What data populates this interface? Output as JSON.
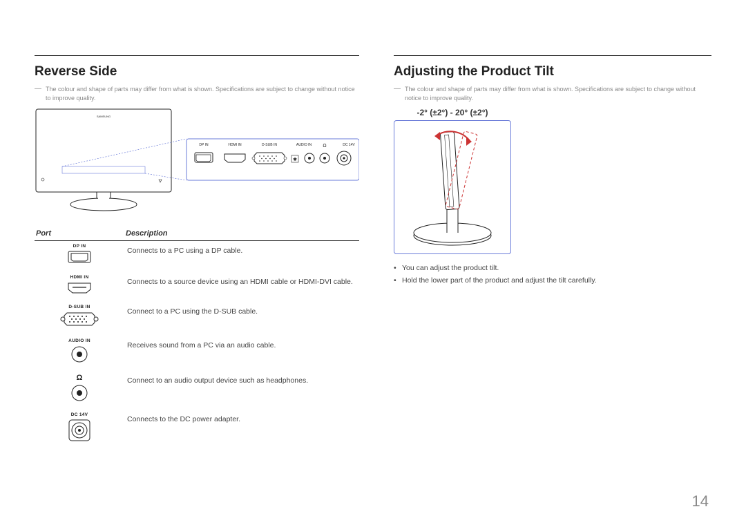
{
  "page_number": "14",
  "left": {
    "title": "Reverse Side",
    "note": "The colour and shape of parts may differ from what is shown. Specifications are subject to change without notice to improve quality.",
    "port_panel_labels": [
      "DP IN",
      "HDMI IN",
      "D-SUB IN",
      "AUDIO IN",
      "",
      "DC 14V"
    ],
    "port_table": {
      "headers": [
        "Port",
        "Description"
      ],
      "rows": [
        {
          "label": "DP IN",
          "icon": "dp",
          "desc": "Connects to a PC using a DP cable."
        },
        {
          "label": "HDMI IN",
          "icon": "hdmi",
          "desc": "Connects to a source device using an HDMI cable or HDMI-DVI cable."
        },
        {
          "label": "D-SUB IN",
          "icon": "dsub",
          "desc": "Connect to a PC using the D-SUB cable."
        },
        {
          "label": "AUDIO IN",
          "icon": "jack",
          "desc": "Receives sound from a PC via an audio cable."
        },
        {
          "label": "",
          "icon": "headphone",
          "desc": "Connect to an audio output device such as headphones."
        },
        {
          "label": "DC 14V",
          "icon": "dc",
          "desc": "Connects to the DC power adapter."
        }
      ]
    },
    "headphone_glyph": "Ω"
  },
  "right": {
    "title": "Adjusting the Product Tilt",
    "note": "The colour and shape of parts may differ from what is shown. Specifications are subject to change without notice to improve quality.",
    "tilt_range": "-2° (±2°) - 20° (±2°)",
    "bullets": [
      "You can adjust the product tilt.",
      "Hold the lower part of the product and adjust the tilt carefully."
    ]
  },
  "monitor_brand": "SAMSUNG"
}
